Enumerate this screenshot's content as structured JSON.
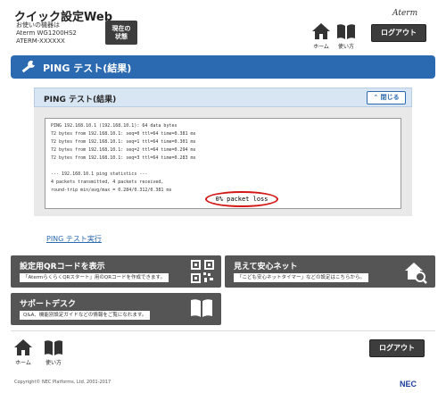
{
  "header": {
    "site_title": "クイック設定Web",
    "device_caption": "お使いの機器は",
    "model": "Aterm WG1200HS2",
    "device_id": "ATERM-XXXXXX",
    "status_button": "現在の状態",
    "brand": "Aterm",
    "home_label": "ホーム",
    "guide_label": "使い方",
    "logout_label": "ログアウト"
  },
  "page": {
    "title": "PING テスト(結果)"
  },
  "result_panel": {
    "heading": "PING テスト(結果)",
    "close_label": "閉じる",
    "log_lines": [
      "PING 192.168.10.1 (192.168.10.1): 64 data bytes",
      "72 bytes from 192.168.10.1: seq=0 ttl=64 time=0.381 ms",
      "72 bytes from 192.168.10.1: seq=1 ttl=64 time=0.301 ms",
      "72 bytes from 192.168.10.1: seq=2 ttl=64 time=0.294 ms",
      "72 bytes from 192.168.10.1: seq=3 ttl=64 time=0.283 ms",
      "",
      "--- 192.168.10.1 ping statistics ---",
      "4 packets transmitted, 4 packets received,",
      "round-trip min/avg/max = 0.284/0.312/0.381 ms"
    ],
    "loss_text": "0% packet loss"
  },
  "ping_link": "PING テスト実行",
  "tiles": {
    "qr": {
      "title": "設定用QRコードを表示",
      "desc": "「AtermらくらくQRスタート」用のQRコードを作成できます。"
    },
    "safety": {
      "title": "見えて安心ネット",
      "desc": "「こども安心ネットタイマー」などの設定はこちらから。"
    },
    "support": {
      "title": "サポートデスク",
      "desc": "Q&A、機能別設定ガイドなどの情報をご覧になれます。"
    }
  },
  "footer": {
    "home_label": "ホーム",
    "guide_label": "使い方",
    "logout_label": "ログアウト",
    "copyright": "Copyright© NEC Platforms, Ltd. 2001-2017",
    "company_logo": "NEC"
  },
  "colors": {
    "accent_blue": "#2b6ab0",
    "dark_button": "#3d3d3d",
    "tile_gray": "#555555",
    "highlight_red": "#d41818"
  }
}
